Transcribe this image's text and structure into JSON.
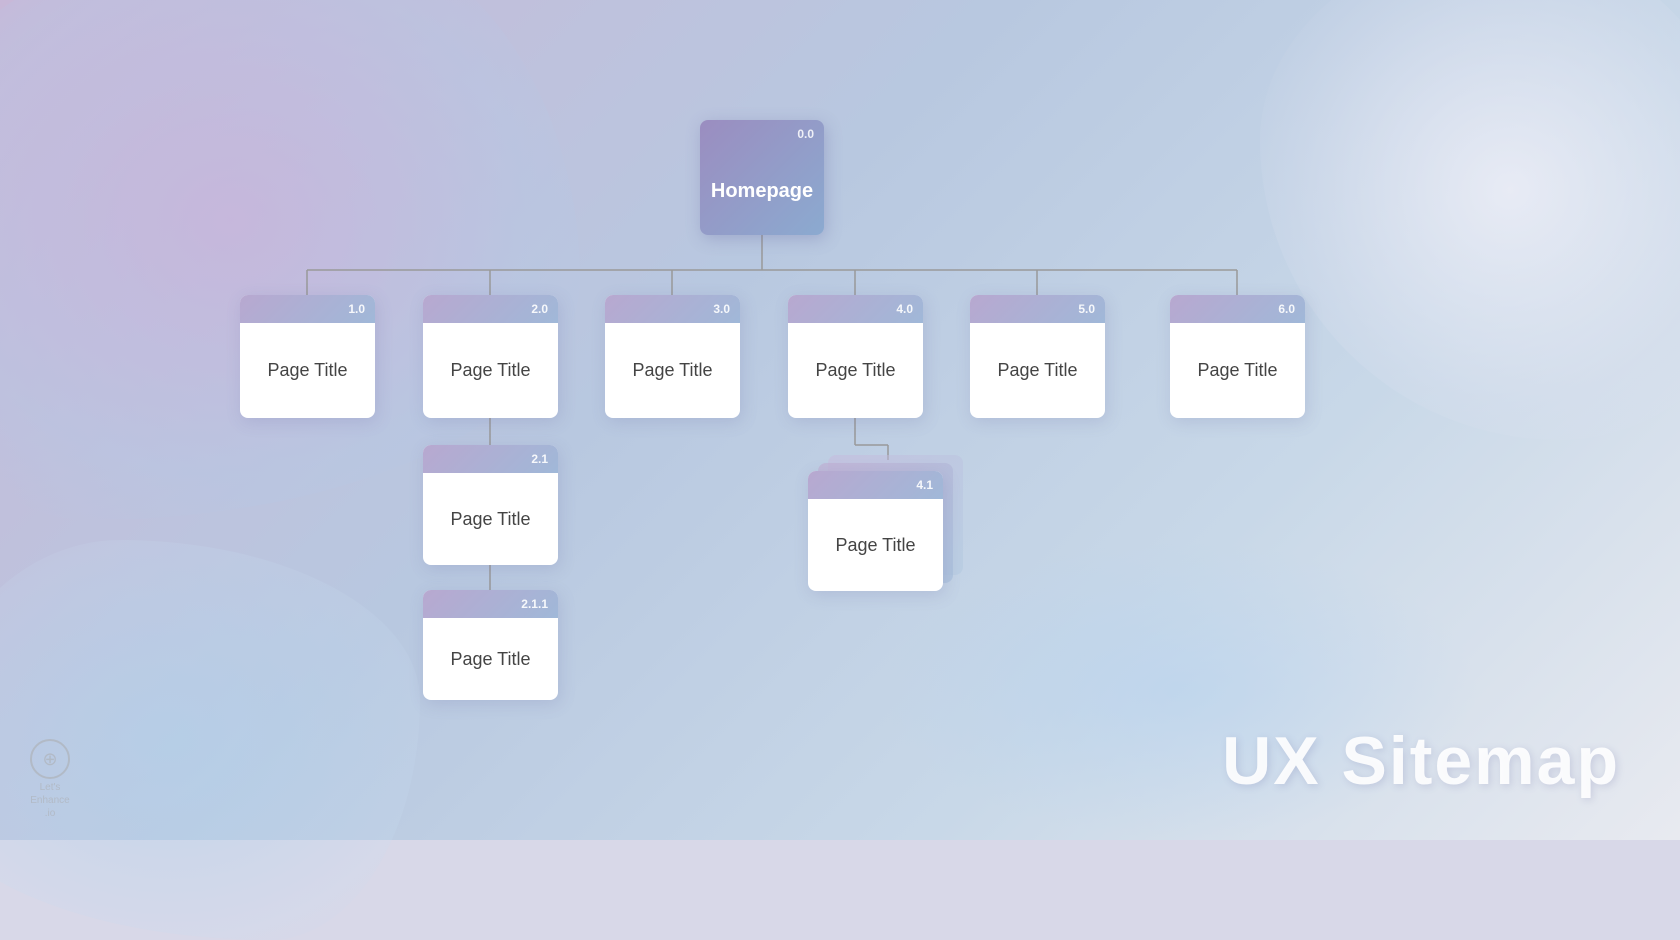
{
  "background": {
    "gradient_start": "#c8b8d8",
    "gradient_end": "#e8eaf0"
  },
  "title": "UX Sitemap",
  "homepage": {
    "id": "0.0",
    "label": "Homepage"
  },
  "nodes": [
    {
      "id": "1.0",
      "label": "Page Title"
    },
    {
      "id": "2.0",
      "label": "Page Title"
    },
    {
      "id": "3.0",
      "label": "Page Title"
    },
    {
      "id": "4.0",
      "label": "Page Title"
    },
    {
      "id": "5.0",
      "label": "Page Title"
    },
    {
      "id": "6.0",
      "label": "Page Title"
    },
    {
      "id": "2.1",
      "label": "Page Title"
    },
    {
      "id": "2.1.1",
      "label": "Page Title"
    },
    {
      "id": "4.1",
      "label": "Page Title"
    }
  ],
  "logo": {
    "text": "Let's Enhance.io",
    "symbol": "⊕"
  }
}
